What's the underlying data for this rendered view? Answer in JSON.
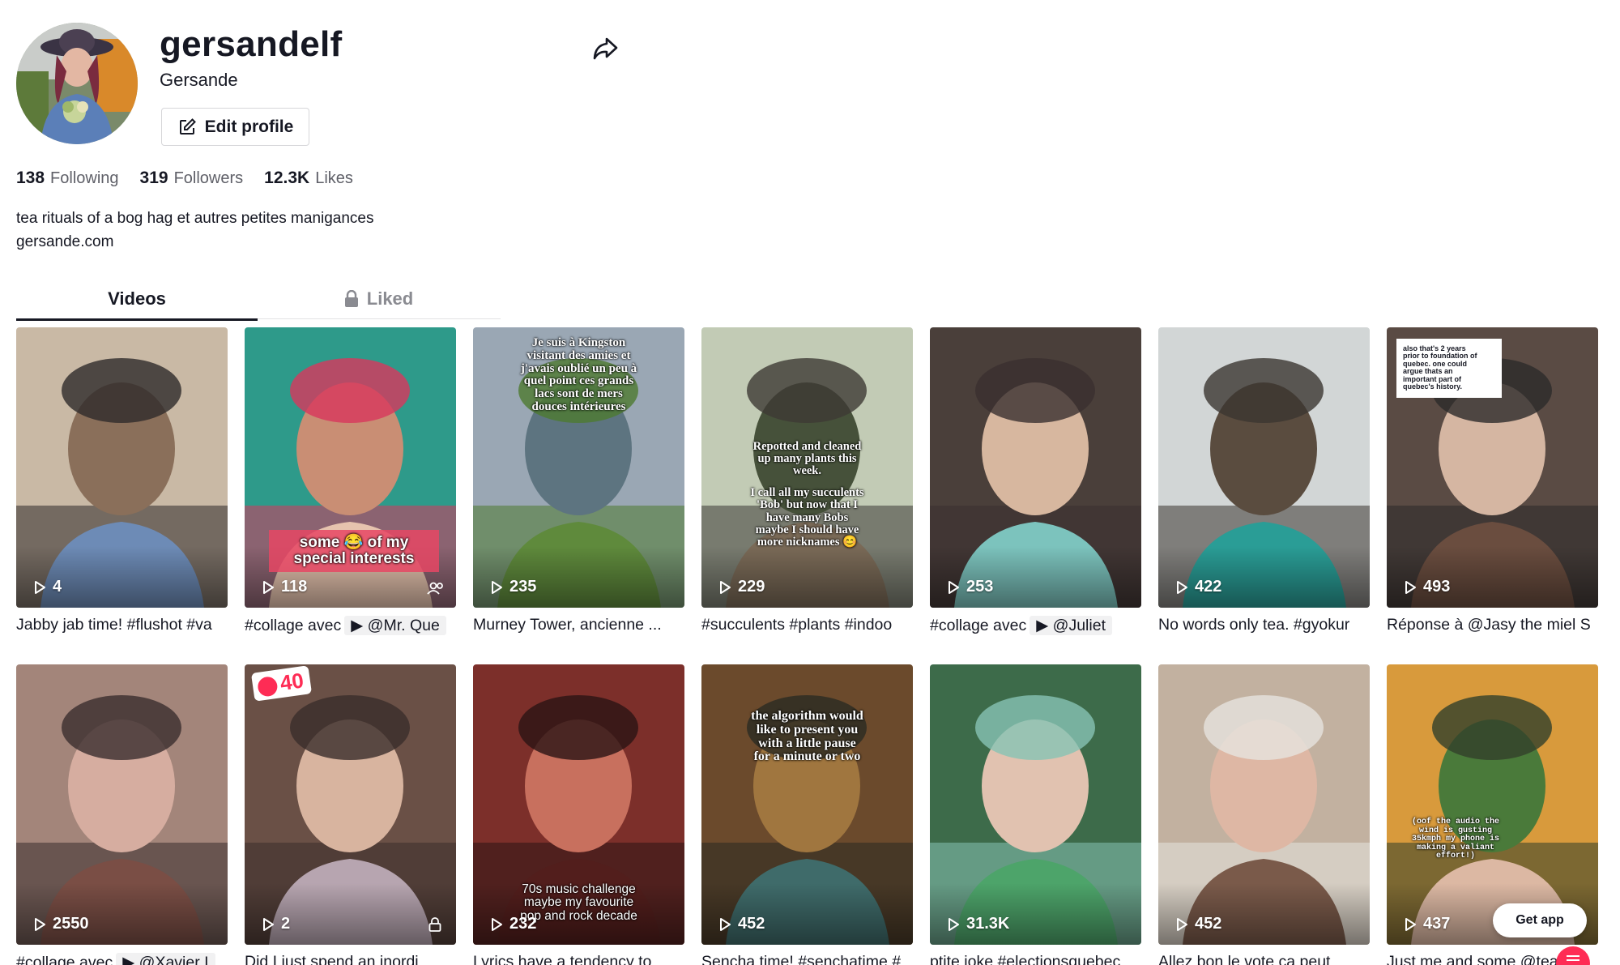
{
  "profile": {
    "username": "gersandelf",
    "nickname": "Gersande",
    "edit_label": "Edit profile",
    "bio": "tea rituals of a bog hag et autres petites manigances",
    "link": "gersande.com"
  },
  "stats": [
    {
      "value": "138",
      "label": "Following"
    },
    {
      "value": "319",
      "label": "Followers"
    },
    {
      "value": "12.3K",
      "label": "Likes"
    }
  ],
  "tabs": {
    "videos": "Videos",
    "liked": "Liked"
  },
  "videos": [
    {
      "views": "4",
      "caption": "Jabby jab time! #flushot #va"
    },
    {
      "views": "118",
      "caption": "#collage avec",
      "ref": "▶ @Mr. Que",
      "overlay": [
        "some 😂 of my",
        "special interests"
      ]
    },
    {
      "views": "235",
      "caption": "Murney Tower, ancienne ...",
      "overlay": [
        "Je suis à Kingston",
        "visitant des amies et",
        "j'avais oublié un peu à",
        "quel point ces grands",
        "lacs sont de mers",
        "douces intérieures"
      ]
    },
    {
      "views": "229",
      "caption": "#succulents #plants #indoo",
      "overlay": [
        "Repotted and cleaned",
        "up many plants this",
        "week.",
        "",
        "I call all my succulents",
        "'Bob' but now that I",
        "have many Bobs",
        "maybe I should have",
        "more nicknames 😊"
      ]
    },
    {
      "views": "253",
      "caption": "#collage avec",
      "ref": "▶ @Juliet"
    },
    {
      "views": "422",
      "caption": "No words only tea. #gyokur"
    },
    {
      "views": "493",
      "caption": "Réponse à @Jasy the miel S",
      "overlay": [
        "also that's 2 years",
        "prior to foundation of",
        "quebec. one could",
        "argue thats an",
        "important part of",
        "quebec's history."
      ]
    },
    {
      "views": "2550",
      "caption": "#collage avec",
      "ref": "▶ @Xavier I"
    },
    {
      "views": "2",
      "caption": "Did I just spend an inordi",
      "badge": "40"
    },
    {
      "views": "232",
      "caption": "Lyrics have a tendency to",
      "overlay": [
        "70s music challenge",
        "maybe my favourite",
        "pop and rock decade"
      ]
    },
    {
      "views": "452",
      "caption": "Sencha time! #senchatime #",
      "overlay": [
        "the algorithm would",
        "like to present you",
        "with a little pause",
        "for a minute or two"
      ]
    },
    {
      "views": "31.3K",
      "caption": "ptite joke #electionsquebec"
    },
    {
      "views": "452",
      "caption": "Allez bon le vote ça peut"
    },
    {
      "views": "437",
      "caption": "Just me and some @tea",
      "overlay": [
        "(oof the audio the",
        "wind is gusting",
        "35kmph my phone is",
        "making a valiant",
        "effort!)"
      ]
    }
  ],
  "get_app": "Get app",
  "colors": {
    "accent": "#fe2c55",
    "text": "#161823",
    "muted": "#8a8b91"
  },
  "icons": [
    "share-icon",
    "edit-icon",
    "lock-icon",
    "play-icon",
    "collab-icon",
    "padlock-icon"
  ]
}
